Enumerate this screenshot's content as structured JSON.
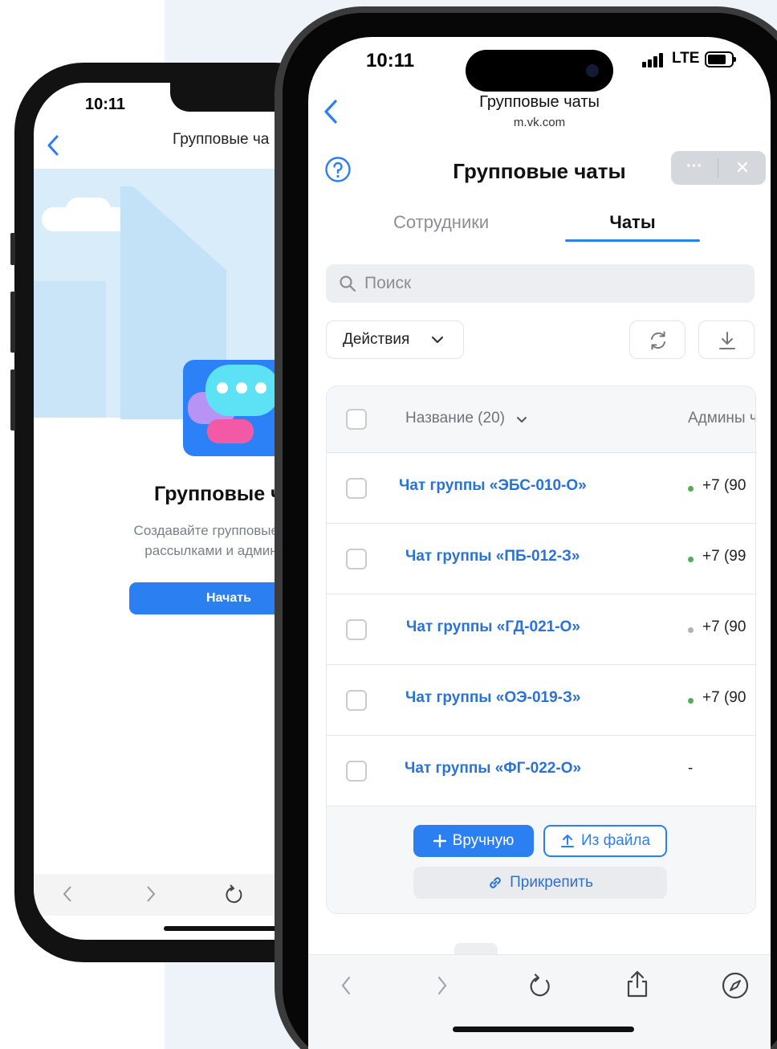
{
  "back_phone": {
    "time": "10:11",
    "nav_title": "Групповые ча",
    "heading": "Групповые ча",
    "description": "Создавайте групповые чат\nрассылками и админис",
    "start_button": "Начать"
  },
  "status_bar": {
    "time": "10:11",
    "network": "LTE"
  },
  "browser_header": {
    "title": "Групповые чаты",
    "url": "m.vk.com"
  },
  "app_header": {
    "title": "Групповые чаты",
    "more_label": "···",
    "close_label": "✕"
  },
  "tabs": [
    {
      "label": "Сотрудники",
      "active": false
    },
    {
      "label": "Чаты",
      "active": true
    }
  ],
  "search": {
    "placeholder": "Поиск"
  },
  "toolbar": {
    "actions_label": "Действия",
    "refresh_icon": "refresh-icon",
    "download_icon": "download-icon"
  },
  "table": {
    "columns": {
      "name": "Название (20)",
      "admins": "Админы ч"
    },
    "rows": [
      {
        "name": "Чат группы «ЭБС-010-О»",
        "admin": "+7 (90",
        "status": "online",
        "status_color": "#4bb34b"
      },
      {
        "name": "Чат группы «ПБ-012-З»",
        "admin": "+7 (99",
        "status": "online",
        "status_color": "#4bb34b"
      },
      {
        "name": "Чат группы «ГД-021-О»",
        "admin": "+7 (90",
        "status": "offline",
        "status_color": "#aeb3b9"
      },
      {
        "name": "Чат группы «ОЭ-019-З»",
        "admin": "+7 (90",
        "status": "online",
        "status_color": "#4bb34b"
      },
      {
        "name": "Чат группы «ФГ-022-О»",
        "admin": "-",
        "status": "none",
        "status_color": ""
      }
    ]
  },
  "footer_buttons": {
    "manual": "Вручную",
    "from_file": "Из файла",
    "attach": "Прикрепить"
  },
  "colors": {
    "accent": "#2b7ff0",
    "link": "#2a72d4",
    "online": "#4bb34b",
    "offline": "#aeb3b9"
  }
}
